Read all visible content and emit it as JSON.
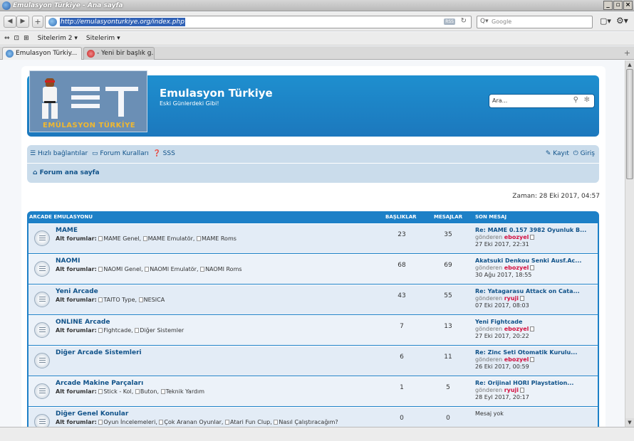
{
  "window": {
    "title": "Emulasyon Türkiye - Ana sayfa"
  },
  "browser": {
    "url": "http://emulasyonturkiye.org/index.php",
    "rss": "RSS",
    "search_placeholder": "Google",
    "bookmarks": [
      "Sitelerim 2",
      "Sitelerim"
    ],
    "tabs": [
      {
        "label": "Emulasyon Türkiy..."
      },
      {
        "label": "- Yeni bir başlık g..."
      }
    ]
  },
  "site": {
    "logo_text": "EMÜLASYON TÜRKİYE",
    "title": "Emulasyon Türkiye",
    "description": "Eski Günlerdeki Gibi!",
    "search_placeholder": "Ara...",
    "nav": {
      "quick_links": "Hızlı bağlantılar",
      "rules": "Forum Kuralları",
      "faq": "SSS",
      "register": "Kayıt",
      "login": "Giriş",
      "home": "Forum ana sayfa"
    },
    "time": "Zaman: 28 Eki 2017, 04:57"
  },
  "table": {
    "category": "ARCADE EMULASYONU",
    "col_topics": "BAŞLIKLAR",
    "col_posts": "MESAJLAR",
    "col_last": "SON MESAJ",
    "subforum_label": "Alt forumlar:",
    "by_label": "gönderen",
    "no_post": "Mesaj yok",
    "rows": [
      {
        "name": "MAME",
        "subs": "MAME Genel, MAME Emulatör, MAME Roms",
        "topics": "23",
        "posts": "35",
        "last_title": "Re: MAME 0.157 3982 Oyunluk B...",
        "last_user": "ebozyel",
        "last_date": "27 Eki 2017, 22:31"
      },
      {
        "name": "NAOMI",
        "subs": "NAOMI Genel, NAOMI Emulatör, NAOMI Roms",
        "topics": "68",
        "posts": "69",
        "last_title": "Akatsuki Denkou Senki Ausf.Ac...",
        "last_user": "ebozyel",
        "last_date": "30 Ağu 2017, 18:55"
      },
      {
        "name": "Yeni Arcade",
        "subs": "TAITO Type, NESICA",
        "topics": "43",
        "posts": "55",
        "last_title": "Re: Yatagarasu Attack on Cata...",
        "last_user": "ryuji",
        "last_date": "07 Eki 2017, 08:03"
      },
      {
        "name": "ONLINE Arcade",
        "subs": "Fightcade, Diğer Sistemler",
        "topics": "7",
        "posts": "13",
        "last_title": "Yeni Fightcade",
        "last_user": "ebozyel",
        "last_date": "27 Eki 2017, 20:22"
      },
      {
        "name": "Diğer Arcade Sistemleri",
        "subs": "",
        "topics": "6",
        "posts": "11",
        "last_title": "Re: Zinc Seti Otomatik Kurulu...",
        "last_user": "ebozyel",
        "last_date": "26 Eki 2017, 00:59"
      },
      {
        "name": "Arcade Makine Parçaları",
        "subs": "Stick - Kol, Buton, Teknik Yardım",
        "topics": "1",
        "posts": "5",
        "last_title": "Re: Orijinal HORI Playstation...",
        "last_user": "ryuji",
        "last_date": "28 Eyl 2017, 20:17"
      },
      {
        "name": "Diğer Genel Konular",
        "subs": "Oyun İncelemeleri, Çok Aranan Oyunlar, Atari Fun Clup, Nasıl Çalıştıracağım?",
        "topics": "0",
        "posts": "0",
        "last_title": "",
        "last_user": "",
        "last_date": ""
      }
    ]
  }
}
